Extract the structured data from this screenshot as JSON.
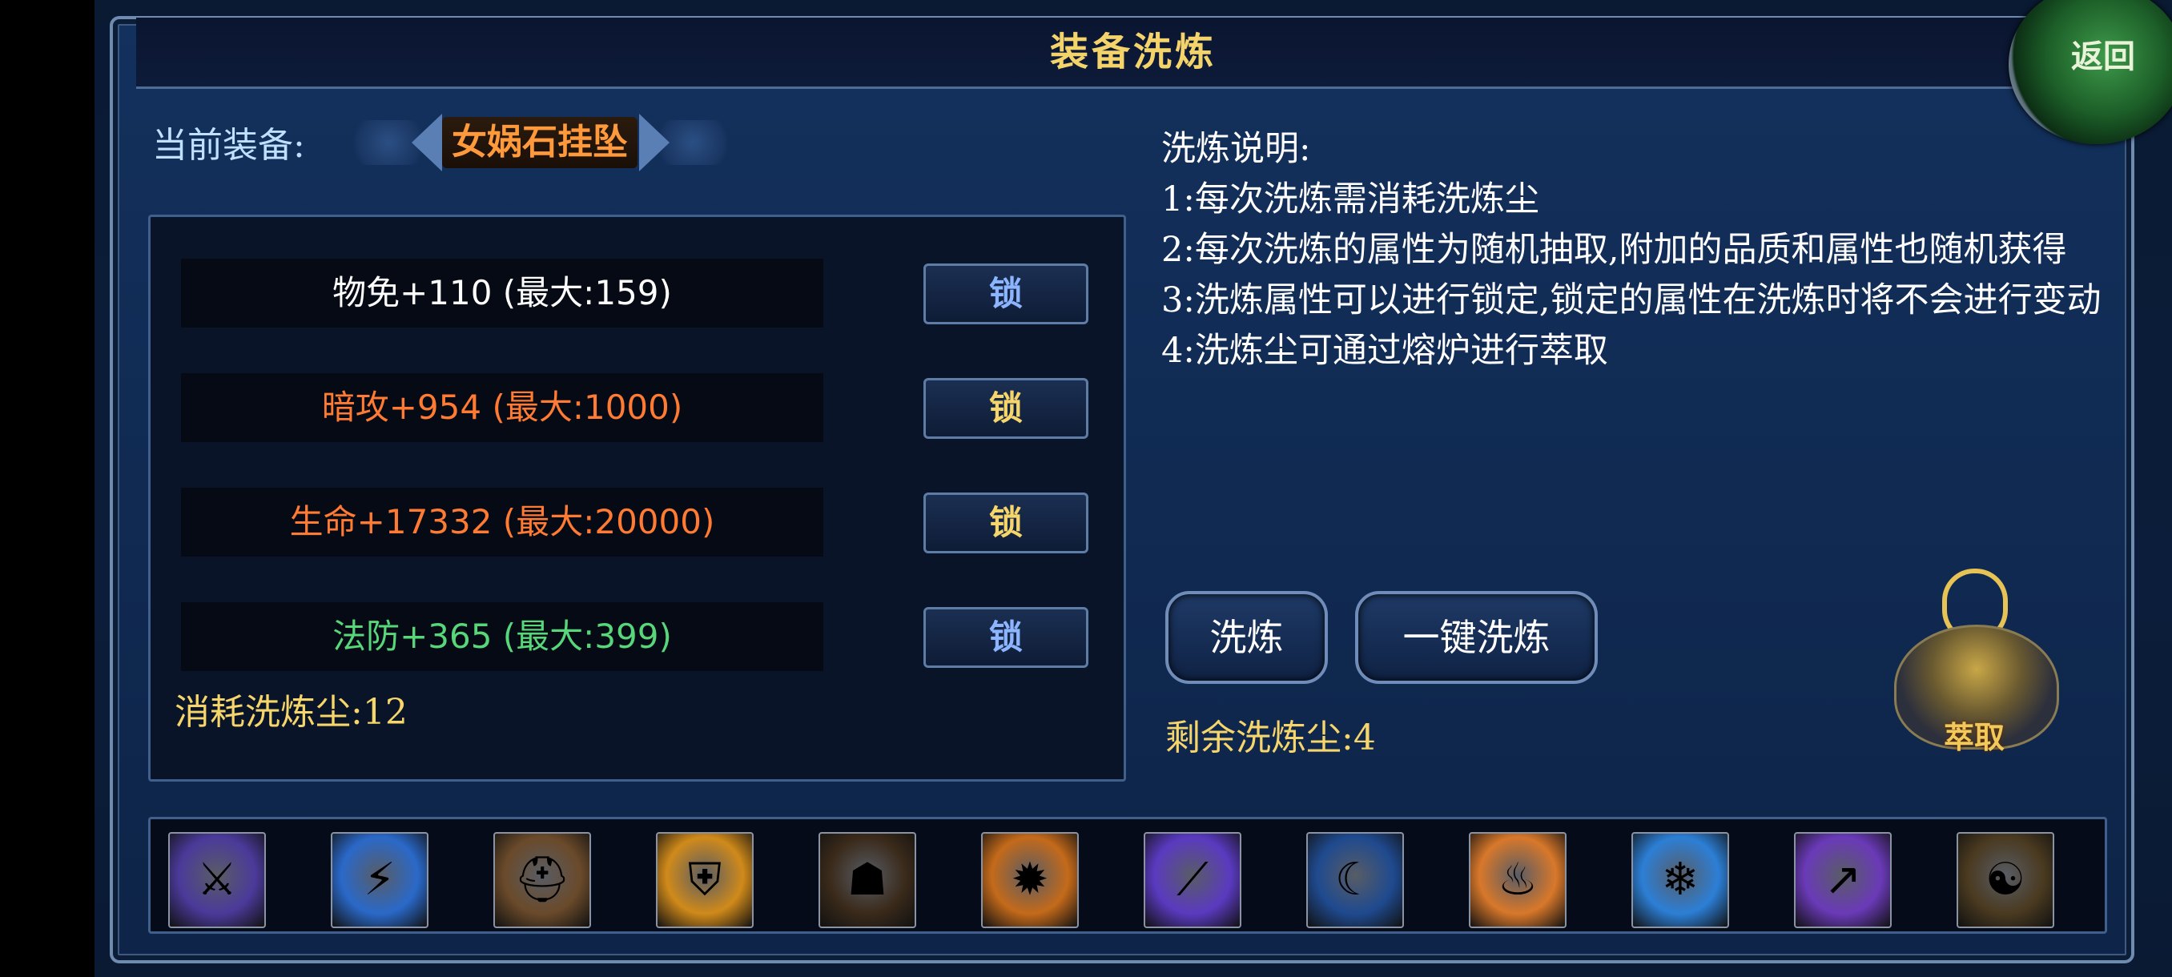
{
  "header": {
    "title": "装备洗炼",
    "back_label": "返回"
  },
  "current_equipment": {
    "label": "当前装备:",
    "name": "女娲石挂坠"
  },
  "attributes": [
    {
      "text": "物免+110  (最大:159)",
      "color": "#ffffff",
      "lock_label": "锁",
      "lock_color": "#8db5ff"
    },
    {
      "text": "暗攻+954  (最大:1000)",
      "color": "#ff7a32",
      "lock_label": "锁",
      "lock_color": "#f6d56a"
    },
    {
      "text": "生命+17332  (最大:20000)",
      "color": "#ff7a32",
      "lock_label": "锁",
      "lock_color": "#f6d56a"
    },
    {
      "text": "法防+365  (最大:399)",
      "color": "#57d67a",
      "lock_label": "锁",
      "lock_color": "#8db5ff"
    }
  ],
  "cost": {
    "text": "消耗洗炼尘:12"
  },
  "description": {
    "title": "洗炼说明:",
    "items": [
      "1:每次洗炼需消耗洗炼尘",
      "2:每次洗炼的属性为随机抽取,附加的品质和属性也随机获得",
      "3:洗炼属性可以进行锁定,锁定的属性在洗炼时将不会进行变动",
      "4:洗炼尘可通过熔炉进行萃取"
    ]
  },
  "actions": {
    "refine": "洗炼",
    "one_click": "一键洗炼"
  },
  "remaining": {
    "text": "剩余洗炼尘:4"
  },
  "extract": {
    "label": "萃取"
  },
  "skills": [
    {
      "icon": "green-axe-icon",
      "glyph": "⚔",
      "bg": "#4b3a9a"
    },
    {
      "icon": "lightning-icon",
      "glyph": "⚡",
      "bg": "#2a69c9"
    },
    {
      "icon": "helmet-icon",
      "glyph": "⛑",
      "bg": "#6a4a2a"
    },
    {
      "icon": "golden-shield-icon",
      "glyph": "⛨",
      "bg": "#d08a1a"
    },
    {
      "icon": "shadow-figure-icon",
      "glyph": "☗",
      "bg": "#3a2a1a"
    },
    {
      "icon": "flame-boot-icon",
      "glyph": "✹",
      "bg": "#c46a1a"
    },
    {
      "icon": "violet-slash-icon",
      "glyph": "⟋",
      "bg": "#5a3ac0"
    },
    {
      "icon": "blue-blade-icon",
      "glyph": "☾",
      "bg": "#1f4a8f"
    },
    {
      "icon": "fire-warrior-icon",
      "glyph": "♨",
      "bg": "#d8782a"
    },
    {
      "icon": "ice-giant-icon",
      "glyph": "❄",
      "bg": "#2c7fd6"
    },
    {
      "icon": "purple-spear-icon",
      "glyph": "↗",
      "bg": "#6a3ab8"
    },
    {
      "icon": "meditation-icon",
      "glyph": "☯",
      "bg": "#4a3a20"
    }
  ]
}
